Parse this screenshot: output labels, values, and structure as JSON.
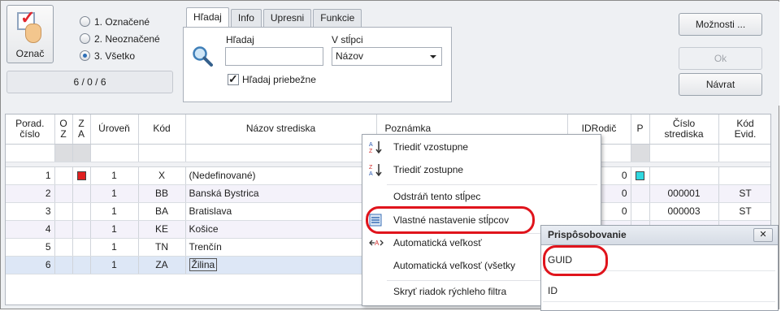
{
  "mark_button": {
    "label": "Označ"
  },
  "radios": [
    {
      "label": "1. Označené",
      "checked": false
    },
    {
      "label": "2. Neoznačené",
      "checked": false
    },
    {
      "label": "3. Všetko",
      "checked": true
    }
  ],
  "counter": "6 / 0 / 6",
  "tabs": [
    {
      "label": "Hľadaj",
      "active": true
    },
    {
      "label": "Info",
      "active": false
    },
    {
      "label": "Upresni",
      "active": false
    },
    {
      "label": "Funkcie",
      "active": false
    }
  ],
  "search": {
    "label": "Hľadaj",
    "value": "",
    "column_label": "V stĺpci",
    "column_value": "Názov",
    "live_label": "Hľadaj priebežne",
    "live_checked": true
  },
  "buttons": {
    "options": "Možnosti ...",
    "ok": "Ok",
    "back": "Návrat"
  },
  "grid": {
    "columns": [
      "Porad.\nčíslo",
      "O\nZ",
      "Z\nA",
      "Úroveň",
      "Kód",
      "Názov strediska",
      "Poznámka",
      "IDRodič",
      "P",
      "Číslo\nstrediska",
      "Kód\nEvid."
    ],
    "rows": [
      {
        "n": "1",
        "oz": "",
        "za": "red",
        "level": "1",
        "code": "X",
        "name": "(Nedefinované)",
        "idrodic": "0",
        "p": "cyan",
        "cislo": "",
        "evid": ""
      },
      {
        "n": "2",
        "oz": "",
        "za": "",
        "level": "1",
        "code": "BB",
        "name": "Banská Bystrica",
        "idrodic": "0",
        "p": "empty",
        "cislo": "000001",
        "evid": "ST"
      },
      {
        "n": "3",
        "oz": "",
        "za": "",
        "level": "1",
        "code": "BA",
        "name": "Bratislava",
        "idrodic": "0",
        "p": "empty",
        "cislo": "000003",
        "evid": "ST"
      },
      {
        "n": "4",
        "oz": "",
        "za": "",
        "level": "1",
        "code": "KE",
        "name": "Košice",
        "idrodic": "",
        "p": "",
        "cislo": "",
        "evid": ""
      },
      {
        "n": "5",
        "oz": "",
        "za": "",
        "level": "1",
        "code": "TN",
        "name": "Trenčín",
        "idrodic": "",
        "p": "",
        "cislo": "",
        "evid": ""
      },
      {
        "n": "6",
        "oz": "",
        "za": "",
        "level": "1",
        "code": "ZA",
        "name": "Žilina",
        "idrodic": "",
        "p": "",
        "cislo": "",
        "evid": ""
      }
    ]
  },
  "context_menu": {
    "items": [
      {
        "label": "Triediť vzostupne",
        "icon": "sort-ascending-icon"
      },
      {
        "label": "Triediť zostupne",
        "icon": "sort-descending-icon"
      },
      {
        "label": "Odstráň tento stĺpec",
        "icon": ""
      },
      {
        "label": "Vlastné nastavenie stĺpcov",
        "icon": "column-chooser-icon"
      },
      {
        "label": "Automatická veľkosť",
        "icon": "autosize-icon"
      },
      {
        "label": "Automatická veľkosť (všetky",
        "icon": ""
      },
      {
        "label": "Skryť riadok rýchleho filtra",
        "icon": ""
      }
    ]
  },
  "customization": {
    "title": "Prispôsobovanie",
    "items": [
      "GUID",
      "ID"
    ]
  },
  "colors": {
    "highlight_oval": "#e0141c",
    "zero_marker": "#e02020",
    "p_marker": "#30d8e0"
  }
}
